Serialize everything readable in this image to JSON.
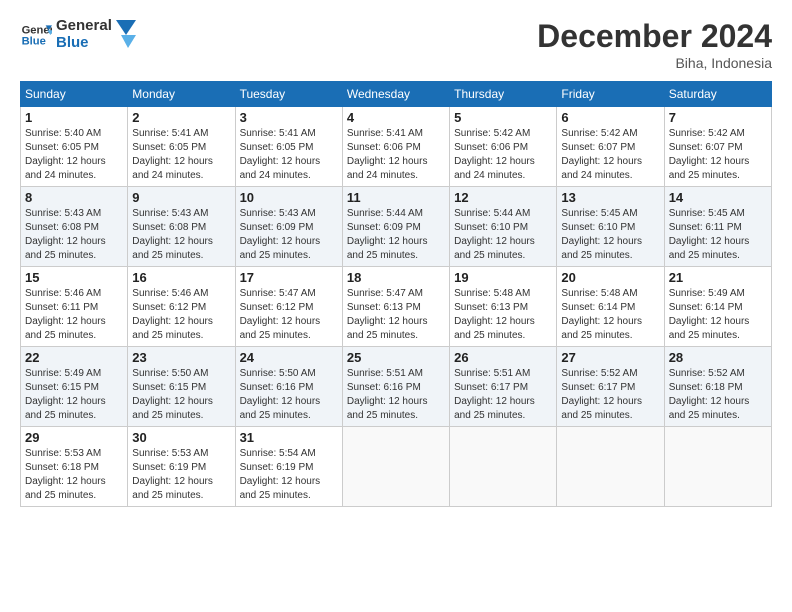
{
  "logo": {
    "line1": "General",
    "line2": "Blue"
  },
  "header": {
    "month": "December 2024",
    "location": "Biha, Indonesia"
  },
  "weekdays": [
    "Sunday",
    "Monday",
    "Tuesday",
    "Wednesday",
    "Thursday",
    "Friday",
    "Saturday"
  ],
  "weeks": [
    [
      {
        "day": 1,
        "sunrise": "5:40 AM",
        "sunset": "6:05 PM",
        "daylight": "12 hours and 24 minutes."
      },
      {
        "day": 2,
        "sunrise": "5:41 AM",
        "sunset": "6:05 PM",
        "daylight": "12 hours and 24 minutes."
      },
      {
        "day": 3,
        "sunrise": "5:41 AM",
        "sunset": "6:05 PM",
        "daylight": "12 hours and 24 minutes."
      },
      {
        "day": 4,
        "sunrise": "5:41 AM",
        "sunset": "6:06 PM",
        "daylight": "12 hours and 24 minutes."
      },
      {
        "day": 5,
        "sunrise": "5:42 AM",
        "sunset": "6:06 PM",
        "daylight": "12 hours and 24 minutes."
      },
      {
        "day": 6,
        "sunrise": "5:42 AM",
        "sunset": "6:07 PM",
        "daylight": "12 hours and 24 minutes."
      },
      {
        "day": 7,
        "sunrise": "5:42 AM",
        "sunset": "6:07 PM",
        "daylight": "12 hours and 25 minutes."
      }
    ],
    [
      {
        "day": 8,
        "sunrise": "5:43 AM",
        "sunset": "6:08 PM",
        "daylight": "12 hours and 25 minutes."
      },
      {
        "day": 9,
        "sunrise": "5:43 AM",
        "sunset": "6:08 PM",
        "daylight": "12 hours and 25 minutes."
      },
      {
        "day": 10,
        "sunrise": "5:43 AM",
        "sunset": "6:09 PM",
        "daylight": "12 hours and 25 minutes."
      },
      {
        "day": 11,
        "sunrise": "5:44 AM",
        "sunset": "6:09 PM",
        "daylight": "12 hours and 25 minutes."
      },
      {
        "day": 12,
        "sunrise": "5:44 AM",
        "sunset": "6:10 PM",
        "daylight": "12 hours and 25 minutes."
      },
      {
        "day": 13,
        "sunrise": "5:45 AM",
        "sunset": "6:10 PM",
        "daylight": "12 hours and 25 minutes."
      },
      {
        "day": 14,
        "sunrise": "5:45 AM",
        "sunset": "6:11 PM",
        "daylight": "12 hours and 25 minutes."
      }
    ],
    [
      {
        "day": 15,
        "sunrise": "5:46 AM",
        "sunset": "6:11 PM",
        "daylight": "12 hours and 25 minutes."
      },
      {
        "day": 16,
        "sunrise": "5:46 AM",
        "sunset": "6:12 PM",
        "daylight": "12 hours and 25 minutes."
      },
      {
        "day": 17,
        "sunrise": "5:47 AM",
        "sunset": "6:12 PM",
        "daylight": "12 hours and 25 minutes."
      },
      {
        "day": 18,
        "sunrise": "5:47 AM",
        "sunset": "6:13 PM",
        "daylight": "12 hours and 25 minutes."
      },
      {
        "day": 19,
        "sunrise": "5:48 AM",
        "sunset": "6:13 PM",
        "daylight": "12 hours and 25 minutes."
      },
      {
        "day": 20,
        "sunrise": "5:48 AM",
        "sunset": "6:14 PM",
        "daylight": "12 hours and 25 minutes."
      },
      {
        "day": 21,
        "sunrise": "5:49 AM",
        "sunset": "6:14 PM",
        "daylight": "12 hours and 25 minutes."
      }
    ],
    [
      {
        "day": 22,
        "sunrise": "5:49 AM",
        "sunset": "6:15 PM",
        "daylight": "12 hours and 25 minutes."
      },
      {
        "day": 23,
        "sunrise": "5:50 AM",
        "sunset": "6:15 PM",
        "daylight": "12 hours and 25 minutes."
      },
      {
        "day": 24,
        "sunrise": "5:50 AM",
        "sunset": "6:16 PM",
        "daylight": "12 hours and 25 minutes."
      },
      {
        "day": 25,
        "sunrise": "5:51 AM",
        "sunset": "6:16 PM",
        "daylight": "12 hours and 25 minutes."
      },
      {
        "day": 26,
        "sunrise": "5:51 AM",
        "sunset": "6:17 PM",
        "daylight": "12 hours and 25 minutes."
      },
      {
        "day": 27,
        "sunrise": "5:52 AM",
        "sunset": "6:17 PM",
        "daylight": "12 hours and 25 minutes."
      },
      {
        "day": 28,
        "sunrise": "5:52 AM",
        "sunset": "6:18 PM",
        "daylight": "12 hours and 25 minutes."
      }
    ],
    [
      {
        "day": 29,
        "sunrise": "5:53 AM",
        "sunset": "6:18 PM",
        "daylight": "12 hours and 25 minutes."
      },
      {
        "day": 30,
        "sunrise": "5:53 AM",
        "sunset": "6:19 PM",
        "daylight": "12 hours and 25 minutes."
      },
      {
        "day": 31,
        "sunrise": "5:54 AM",
        "sunset": "6:19 PM",
        "daylight": "12 hours and 25 minutes."
      },
      null,
      null,
      null,
      null
    ]
  ]
}
